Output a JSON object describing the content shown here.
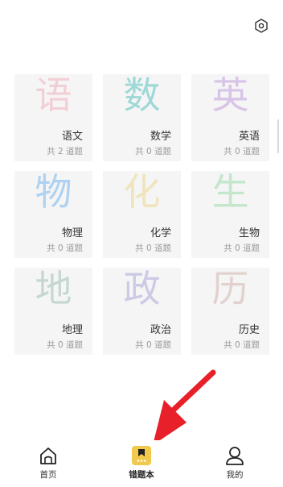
{
  "header": {
    "settings_icon": "hexagon-gear-icon"
  },
  "subjects": [
    {
      "glyph": "语",
      "name": "语文",
      "count": "共 2 道题",
      "color": "#f0a3b0"
    },
    {
      "glyph": "数",
      "name": "数学",
      "count": "共 0 道题",
      "color": "#37b7b3"
    },
    {
      "glyph": "英",
      "name": "英语",
      "count": "共 0 道题",
      "color": "#b58ad8"
    },
    {
      "glyph": "物",
      "name": "物理",
      "count": "共 0 道题",
      "color": "#5aa8e8"
    },
    {
      "glyph": "化",
      "name": "化学",
      "count": "共 0 道题",
      "color": "#e8d27a"
    },
    {
      "glyph": "生",
      "name": "生物",
      "count": "共 0 道题",
      "color": "#8ad49a"
    },
    {
      "glyph": "地",
      "name": "地理",
      "count": "共 0 道题",
      "color": "#8ab6a6"
    },
    {
      "glyph": "政",
      "name": "政治",
      "count": "共 0 道题",
      "color": "#9b97d6"
    },
    {
      "glyph": "历",
      "name": "历史",
      "count": "共 0 道题",
      "color": "#c9a9a2"
    }
  ],
  "tabbar": {
    "home": {
      "label": "首页",
      "icon": "home-icon"
    },
    "mistakes": {
      "label": "错题本",
      "icon": "bookmark-book-icon"
    },
    "mine": {
      "label": "我的",
      "icon": "user-icon"
    }
  },
  "accent": "#f2c94c"
}
